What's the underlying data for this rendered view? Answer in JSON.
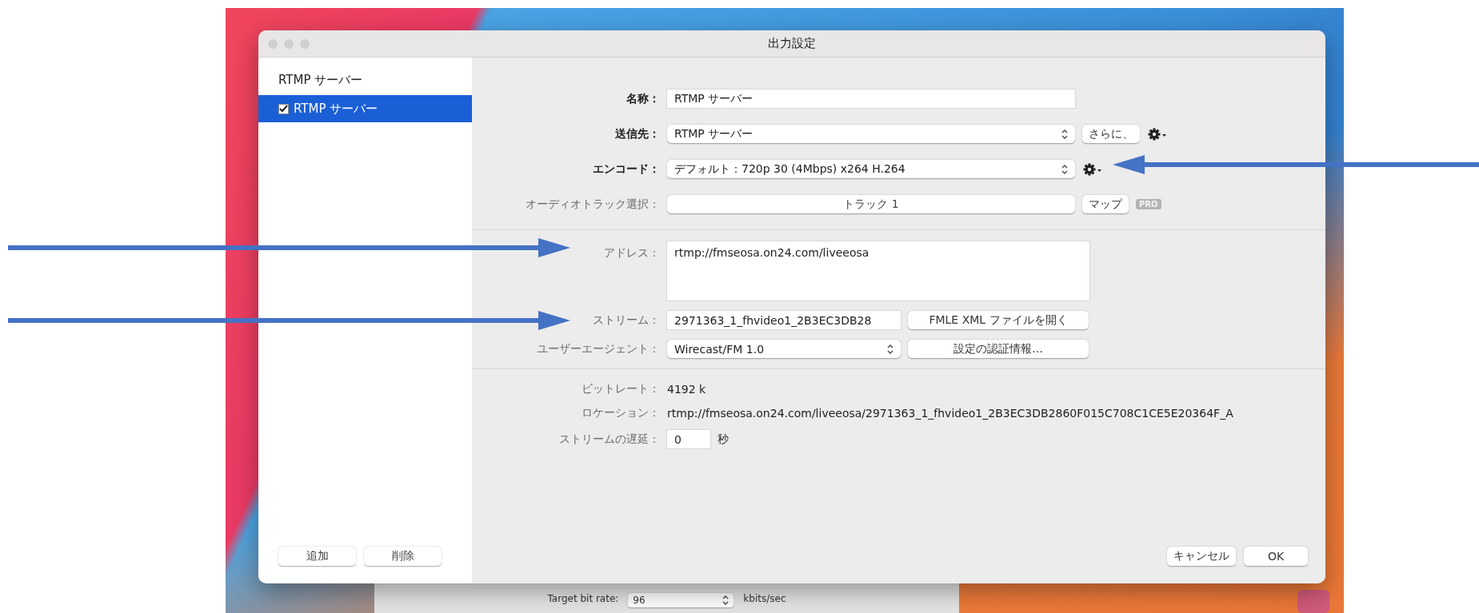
{
  "window": {
    "title": "出力設定"
  },
  "sidebar": {
    "header": "RTMP サーバー",
    "items": [
      {
        "label": "RTMP サーバー",
        "checked": true,
        "selected": true
      }
    ],
    "buttons": [
      "追加",
      "削除"
    ]
  },
  "form": {
    "sections": [
      {
        "rows": [
          {
            "kind": "text",
            "label": "名称：",
            "strong": true,
            "value": "RTMP サーバー"
          },
          {
            "kind": "select",
            "label": "送信先：",
            "strong": true,
            "value": "RTMP サーバー",
            "button": "さらに、",
            "gear": true
          },
          {
            "kind": "select",
            "label": "エンコード：",
            "strong": true,
            "value": "デフォルト：720p 30 (4Mbps) x264 H.264",
            "gear": true
          },
          {
            "kind": "popup",
            "label": "オーディオトラック選択：",
            "strong": false,
            "value": "トラック 1",
            "button": "マップ",
            "badge": "PRO"
          }
        ]
      },
      {
        "rows": [
          {
            "kind": "textarea",
            "label": "アドレス：",
            "strong": false,
            "value": "rtmp://fmseosa.on24.com/liveeosa"
          },
          {
            "kind": "text",
            "label": "ストリーム：",
            "strong": false,
            "value": "2971363_1_fhvideo1_2B3EC3DB28",
            "button": "FMLE XML ファイルを開く",
            "narrow": true
          },
          {
            "kind": "select",
            "label": "ユーザーエージェント：",
            "strong": false,
            "value": "Wirecast/FM 1.0",
            "button": "設定の認証情報…",
            "narrow": true
          }
        ]
      },
      {
        "rows": [
          {
            "kind": "info",
            "label": "ビットレート：",
            "strong": false,
            "value": "4192 k"
          },
          {
            "kind": "info",
            "label": "ロケーション：",
            "strong": false,
            "value": "rtmp://fmseosa.on24.com/liveeosa/2971363_1_fhvideo1_2B3EC3DB2860F015C708C1CE5E20364F_A"
          },
          {
            "kind": "number",
            "label": "ストリームの遅延：",
            "strong": false,
            "value": "0",
            "unit": "秒"
          }
        ]
      }
    ],
    "buttons": [
      "キャンセル",
      "OK"
    ]
  },
  "background_window": {
    "label": "Target bit rate:",
    "value": "96",
    "unit": "kbits/sec"
  }
}
